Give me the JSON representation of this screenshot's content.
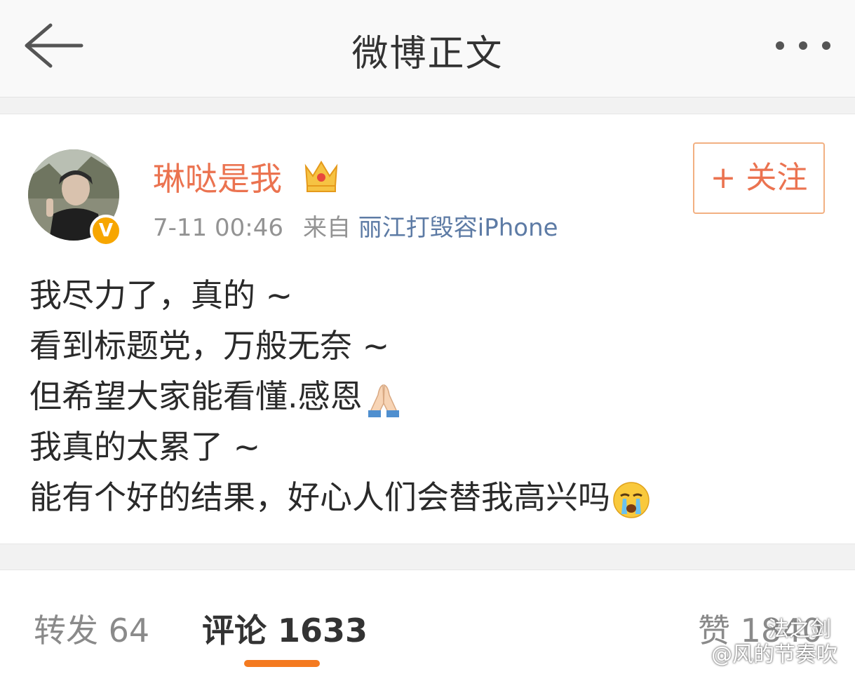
{
  "header": {
    "title": "微博正文"
  },
  "post": {
    "author": "琳哒是我",
    "timestamp": "7-11 00:46",
    "source_prefix": "来自",
    "source": "丽江打毁容iPhone",
    "follow_label": "+ 关注",
    "lines": [
      "我尽力了，真的 ~",
      "看到标题党，万般无奈 ~",
      "但希望大家能看懂.感恩",
      "我真的太累了 ~",
      "能有个好的结果，好心人们会替我高兴吗"
    ],
    "verified_badge": "V",
    "emojis": [
      "praying-hands-icon",
      "crying-face-icon"
    ]
  },
  "tabs": {
    "repost": "转发 64",
    "comment": "评论 1633",
    "like": "赞 1840"
  },
  "watermark": {
    "line1": "法之剑",
    "line2": "@风的节奏吹"
  },
  "colors": {
    "accent": "#eb7350",
    "link": "#5d7ba5",
    "tab_indicator": "#f47a20",
    "verified": "#f7a600"
  }
}
